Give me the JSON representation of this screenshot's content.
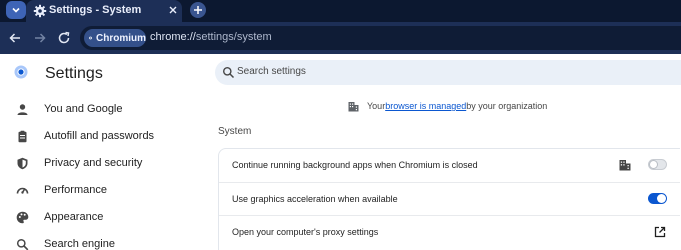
{
  "browser": {
    "tab": {
      "title": "Settings - System",
      "favicon": "gear-icon"
    },
    "toolbar": {
      "back_icon": "back-arrow-icon",
      "forward_icon": "forward-arrow-icon",
      "reload_icon": "reload-icon",
      "site_chip_label": "Chromium",
      "url_scheme_host": "chrome://",
      "url_path": "settings/system"
    }
  },
  "page": {
    "title": "Settings",
    "search": {
      "placeholder": "Search settings",
      "value": ""
    }
  },
  "sidebar": {
    "items": [
      {
        "label": "You and Google",
        "icon": "person-icon"
      },
      {
        "label": "Autofill and passwords",
        "icon": "clipboard-icon"
      },
      {
        "label": "Privacy and security",
        "icon": "shield-icon"
      },
      {
        "label": "Performance",
        "icon": "speedometer-icon"
      },
      {
        "label": "Appearance",
        "icon": "palette-icon"
      },
      {
        "label": "Search engine",
        "icon": "search-icon"
      }
    ]
  },
  "managed_notice": {
    "prefix": "Your ",
    "link": "browser is managed",
    "suffix": " by your organization"
  },
  "system": {
    "section_title": "System",
    "rows": [
      {
        "label": "Continue running background apps when Chromium is closed",
        "control": "toggle",
        "checked": false,
        "policy_managed": true
      },
      {
        "label": "Use graphics acceleration when available",
        "control": "toggle",
        "checked": true
      },
      {
        "label": "Open your computer's proxy settings",
        "control": "external-link"
      }
    ]
  },
  "colors": {
    "accent": "#0b57d0",
    "tab_strip": "#0c1830",
    "toolbar": "#1d2f57",
    "search_bg": "#eaf0f8"
  }
}
